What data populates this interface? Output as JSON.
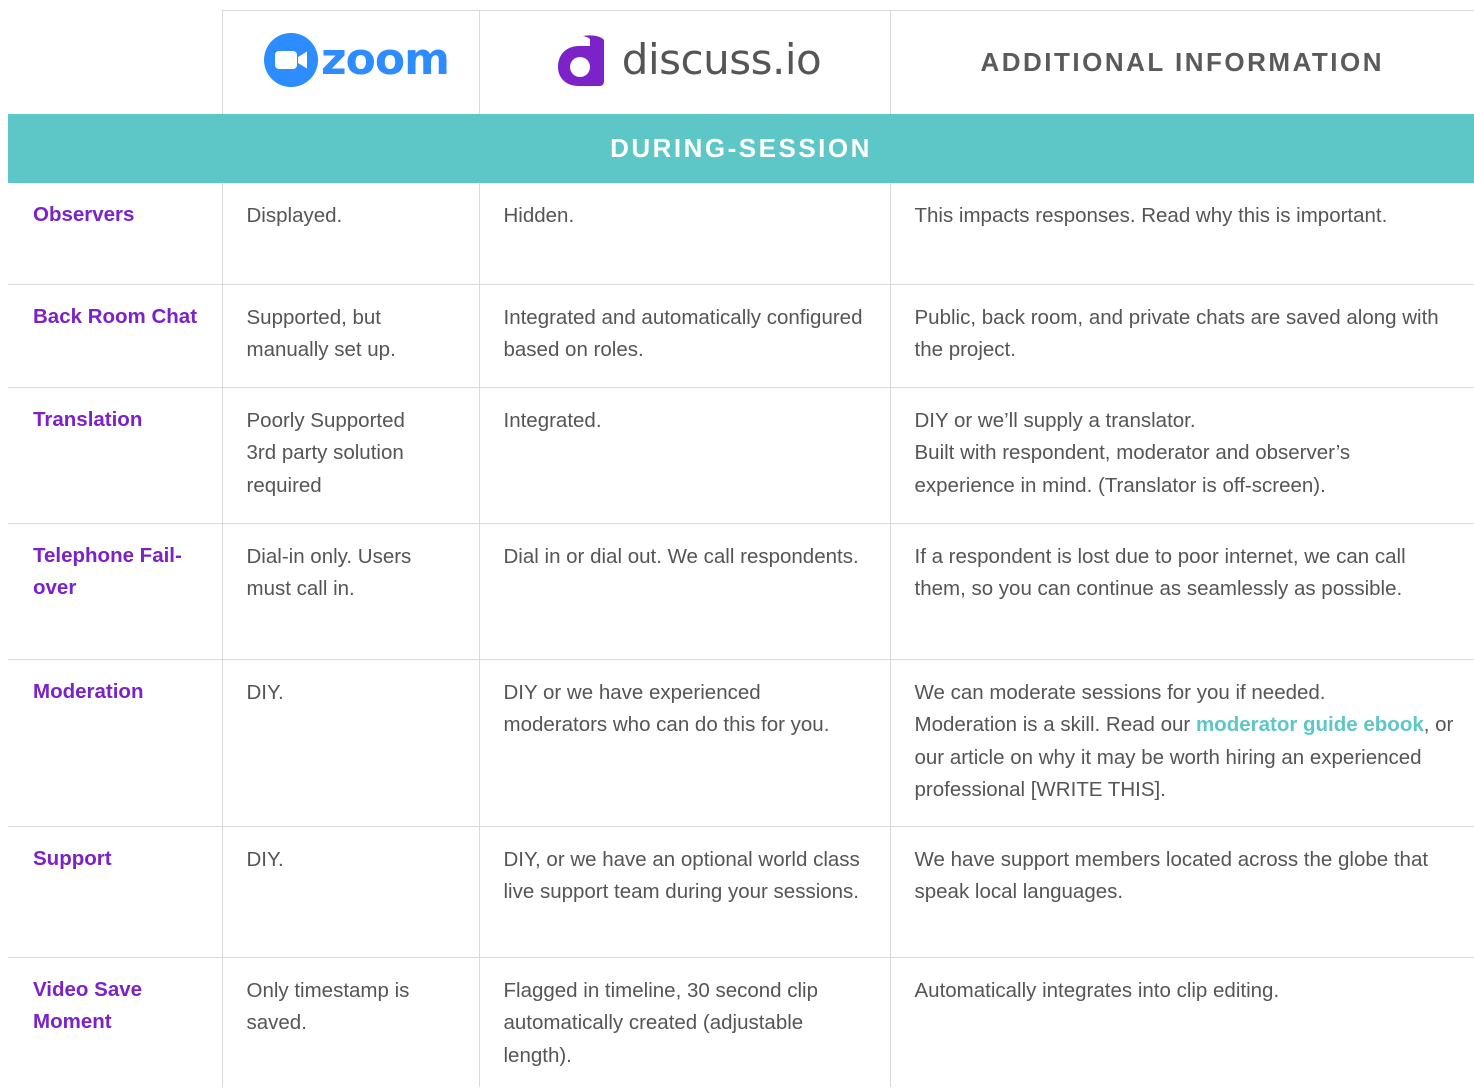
{
  "header": {
    "zoom_logo_text": "zoom",
    "discuss_logo_text": "discuss.io",
    "additional_heading": "ADDITIONAL INFORMATION"
  },
  "section": {
    "title": "DURING-SESSION"
  },
  "rows": [
    {
      "feature": "Observers",
      "zoom": "Displayed.",
      "discuss": "Hidden.",
      "info": "This impacts responses. Read why this is important."
    },
    {
      "feature": "Back Room Chat",
      "zoom": "Supported, but manually set up.",
      "discuss": "Integrated and automatically configured based on roles.",
      "info": "Public, back room, and private chats are saved along with the project."
    },
    {
      "feature": "Translation",
      "zoom_lines": [
        "Poorly Supported",
        "3rd party solution required"
      ],
      "discuss": "Integrated.",
      "info_lines": [
        "DIY or we’ll supply a translator.",
        "Built with respondent, moderator and observer’s experience in mind. (Translator is off-screen)."
      ]
    },
    {
      "feature": "Telephone Fail-over",
      "zoom": "Dial-in only. Users must call in.",
      "discuss": "Dial in or dial out. We call respondents.",
      "info": "If a respondent is lost due to poor internet, we can call them, so you can continue as seamlessly as possible."
    },
    {
      "feature": "Moderation",
      "zoom": "DIY.",
      "discuss": "DIY or we have experienced moderators who can do this for you.",
      "info": {
        "line1": "We can moderate sessions for you if needed.",
        "before_link": "Moderation is a skill. Read our ",
        "link_text": "moderator guide ebook",
        "after_link": ", or our article on why it may be worth hiring an experienced professional [WRITE THIS]."
      }
    },
    {
      "feature": "Support",
      "zoom": "DIY.",
      "discuss": "DIY, or we have an optional world class live support team during your sessions.",
      "info": "We have support members located across the globe that speak local languages."
    },
    {
      "feature": "Video Save Moment",
      "zoom": "Only timestamp is saved.",
      "discuss": "Flagged in timeline, 30 second clip automatically created (adjustable length).",
      "info": "Automatically integrates into clip editing."
    }
  ],
  "colors": {
    "accent_teal": "#5dc6c6",
    "feature_purple": "#7b22c8",
    "zoom_blue": "#2d8cff",
    "discuss_purple": "#7b22c8",
    "body_text": "#555555",
    "grid_line": "#dadada"
  },
  "icons": {
    "zoom": "zoom-camera-icon",
    "discuss": "discuss-d-icon"
  }
}
